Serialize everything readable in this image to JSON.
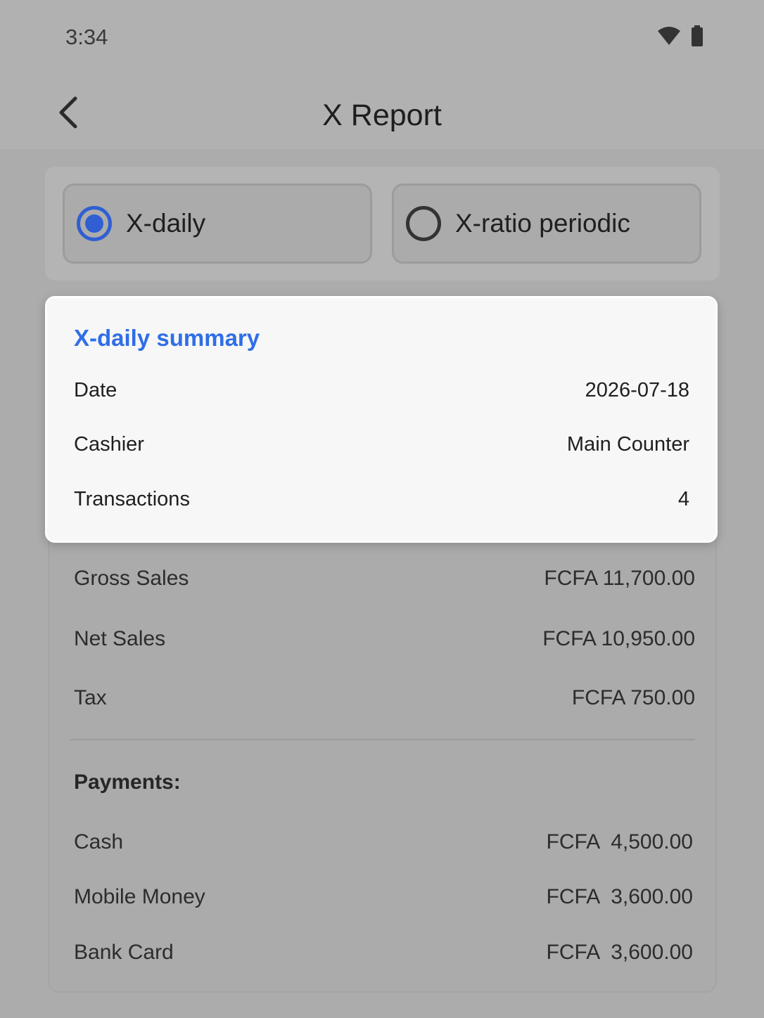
{
  "status_bar": {
    "time": "3:34",
    "icons": [
      "wifi-icon",
      "battery-icon"
    ]
  },
  "app_bar": {
    "title": "X Report",
    "back_icon": "back-arrow-icon"
  },
  "report_type": {
    "options": [
      {
        "label": "X-daily",
        "selected": true
      },
      {
        "label": "X-ratio periodic",
        "selected": false
      }
    ]
  },
  "summary": {
    "title": "X-daily summary",
    "rows": [
      {
        "label": "Date",
        "value": "2026-07-18"
      },
      {
        "label": "Cashier",
        "value": "Main Counter"
      },
      {
        "label": "Transactions",
        "value": "4"
      }
    ]
  },
  "totals": [
    {
      "label": "Gross Sales",
      "value": "FCFA 11,700.00"
    },
    {
      "label": "Net Sales",
      "value": "FCFA 10,950.00"
    },
    {
      "label": "Tax",
      "value": "FCFA 750.00"
    }
  ],
  "payments": {
    "title": "Payments:",
    "items": [
      {
        "label": "Cash",
        "value": "FCFA  4,500.00"
      },
      {
        "label": "Mobile Money",
        "value": "FCFA  3,600.00"
      },
      {
        "label": "Bank Card",
        "value": "FCFA  3,600.00"
      }
    ]
  },
  "colors": {
    "accent": "#2f6ee6",
    "radio": "#2f5fd2",
    "scrim": "#acacac",
    "card": "#f7f7f7"
  }
}
